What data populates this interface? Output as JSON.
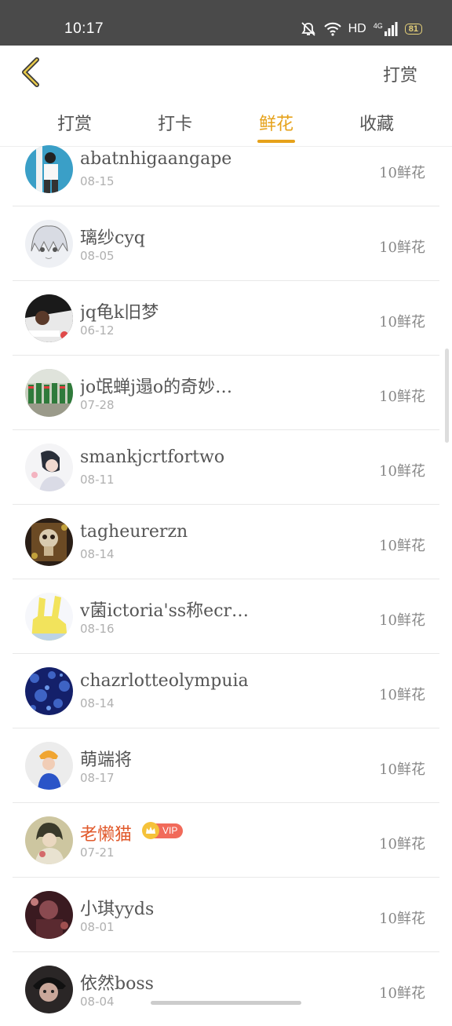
{
  "status_bar": {
    "time": "10:17",
    "network": "HD",
    "signal_type": "4G",
    "battery": "81"
  },
  "header": {
    "action_label": "打赏"
  },
  "tabs": [
    {
      "label": "打赏",
      "active": false
    },
    {
      "label": "打卡",
      "active": false
    },
    {
      "label": "鲜花",
      "active": true
    },
    {
      "label": "收藏",
      "active": false
    }
  ],
  "list": [
    {
      "name": "abatnhigaangape",
      "date": "08-15",
      "amount": "10鲜花"
    },
    {
      "name": "璃纱cyq",
      "date": "08-05",
      "amount": "10鲜花"
    },
    {
      "name": "jq龟k旧梦",
      "date": "06-12",
      "amount": "10鲜花"
    },
    {
      "name": "jo氓蝉j遢o的奇妙…",
      "date": "07-28",
      "amount": "10鲜花"
    },
    {
      "name": "smankjcrtfortwo",
      "date": "08-11",
      "amount": "10鲜花"
    },
    {
      "name": "tagheurerzn",
      "date": "08-14",
      "amount": "10鲜花"
    },
    {
      "name": "v菌ictoria'ss称ecr…",
      "date": "08-16",
      "amount": "10鲜花"
    },
    {
      "name": "chazrlotteolympuia",
      "date": "08-14",
      "amount": "10鲜花"
    },
    {
      "name": "萌端将",
      "date": "08-17",
      "amount": "10鲜花"
    },
    {
      "name": "老懒猫",
      "date": "07-21",
      "amount": "10鲜花",
      "vip": "VIP"
    },
    {
      "name": "小琪yyds",
      "date": "08-01",
      "amount": "10鲜花"
    },
    {
      "name": "依然boss",
      "date": "08-04",
      "amount": "10鲜花"
    }
  ],
  "colors": {
    "accent": "#e6a21a",
    "status_bar": "#4a4a4a",
    "vip_name": "#e15a2c"
  }
}
